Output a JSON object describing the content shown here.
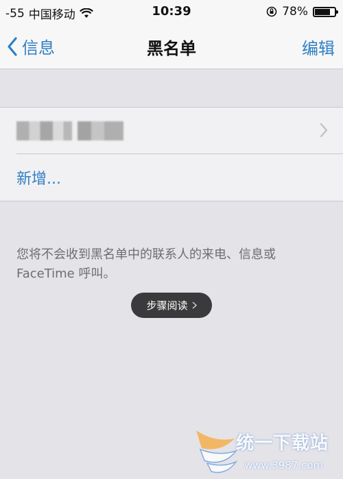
{
  "status_bar": {
    "signal": "-55",
    "carrier": "中国移动",
    "time": "10:39",
    "battery_percent": "78%",
    "battery_level": 0.78
  },
  "nav": {
    "back_label": "信息",
    "title": "黑名单",
    "edit_label": "编辑"
  },
  "list": {
    "add_label": "新增..."
  },
  "footnote": "您将不会收到黑名单中的联系人的来电、信息或 FaceTime 呼叫。",
  "overlay": {
    "step_read_label": "步骤阅读"
  },
  "watermark": {
    "brand": "统一下载站",
    "url": "www.3987.com"
  },
  "colors": {
    "accent": "#2f7fc4",
    "background": "#e4e3e8",
    "overlay_pill": "#3a3a3c"
  }
}
